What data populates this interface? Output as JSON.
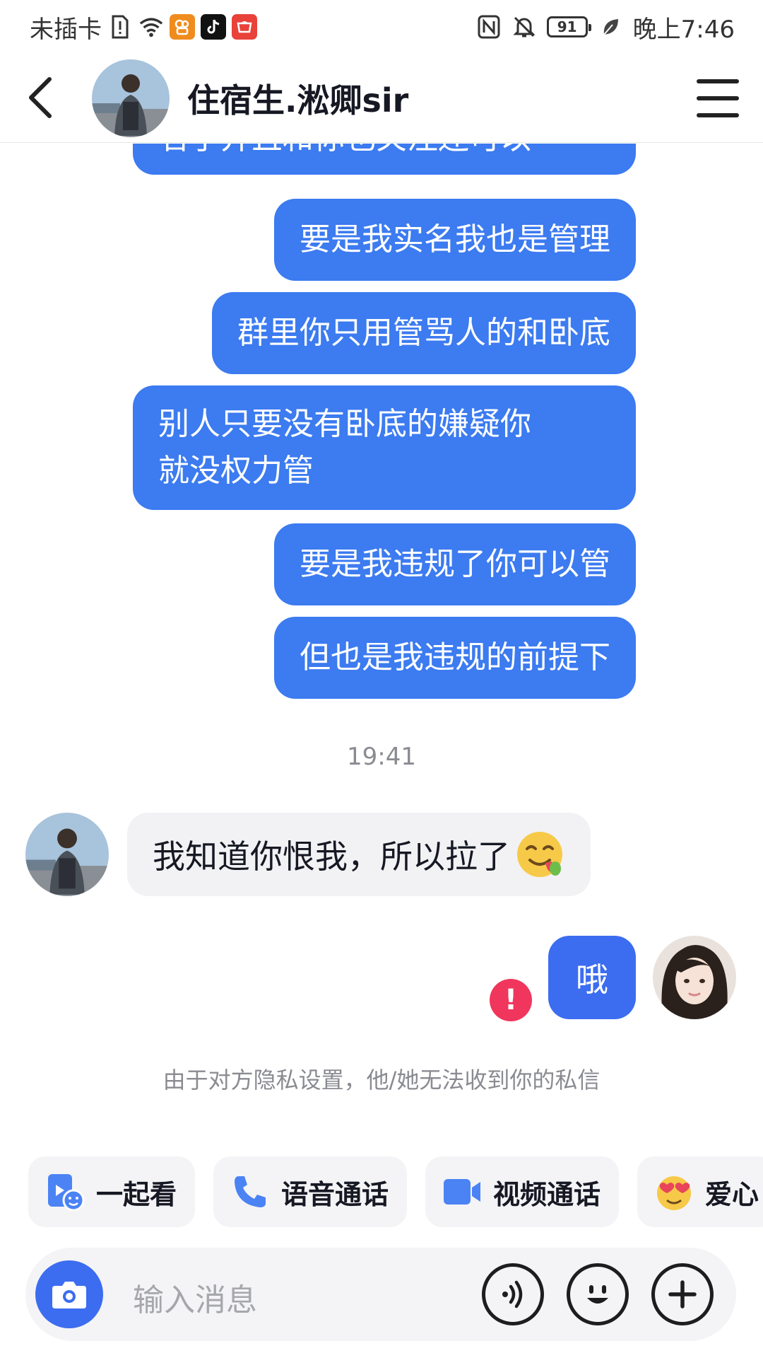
{
  "status_bar": {
    "carrier": "未插卡",
    "battery": "91",
    "time": "晚上7:46"
  },
  "header": {
    "contact_name": "住宿生.淞卿sir"
  },
  "messages": {
    "outgoing": [
      "名了并且和你也关注还可以",
      "要是我实名我也是管理",
      "群里你只用管骂人的和卧底",
      "别人只要没有卧底的嫌疑你",
      "就没权力管",
      "要是我违规了你可以管",
      "但也是我违规的前提下"
    ],
    "timestamp": "19:41",
    "incoming_text": "我知道你恨我，所以拉了",
    "my_reply": "哦",
    "error_mark": "!",
    "privacy_notice": "由于对方隐私设置，他/她无法收到你的私信"
  },
  "quick_actions": [
    {
      "label": "一起看",
      "icon": "watch-together-icon"
    },
    {
      "label": "语音通话",
      "icon": "phone-icon"
    },
    {
      "label": "视频通话",
      "icon": "video-camera-icon"
    },
    {
      "label": "爱心",
      "icon": "heart-eyes-icon"
    }
  ],
  "input": {
    "placeholder": "输入消息"
  },
  "colors": {
    "bubble_out": "#3c7bf0",
    "bubble_me": "#3c6df0",
    "bubble_in": "#f2f2f4",
    "error": "#f0365c"
  }
}
